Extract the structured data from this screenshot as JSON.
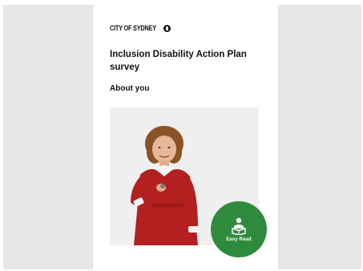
{
  "header": {
    "brand_text": "CITY OF SYDNEY",
    "brand_mark_icon": "city-of-sydney-logo-mark"
  },
  "page": {
    "title": "Inclusion Disability Action Plan survey",
    "section_heading": "About you"
  },
  "hero_image": {
    "icon": "person-photo"
  },
  "easy_read_button": {
    "label": "Easy Read",
    "icon": "person-reading-icon",
    "color": "#2e8b3d"
  },
  "colors": {
    "background": "#e6e6e6",
    "card": "#ffffff",
    "text": "#111111",
    "accent": "#2e8b3d",
    "dress": "#b3201f"
  }
}
